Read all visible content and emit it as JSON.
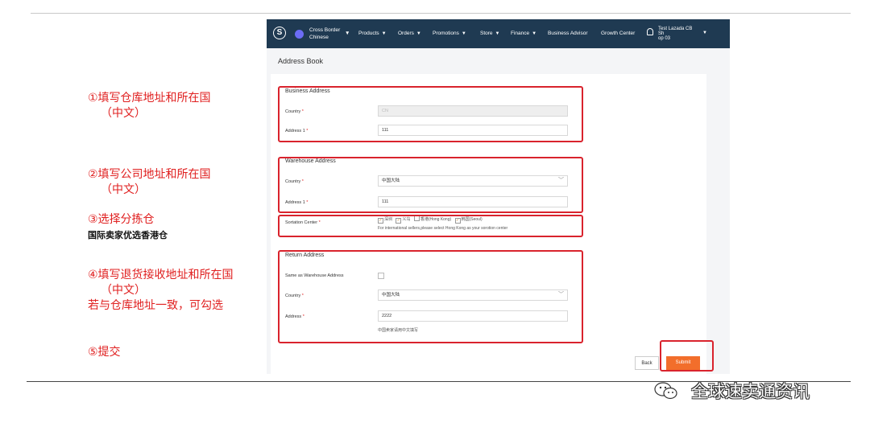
{
  "annotations": {
    "step1_line1": "①填写仓库地址和所在国",
    "step1_line2": "（中文）",
    "step2_line1": "②填写公司地址和所在国",
    "step2_line2": "（中文）",
    "step3_line1": "③选择分拣仓",
    "step3_note": "国际卖家优选香港仓",
    "step4_line1": "④填写退货接收地址和所在国",
    "step4_line2": "（中文）",
    "step4_line3": "若与仓库地址一致，可勾选",
    "step5": "⑤提交"
  },
  "topbar": {
    "logo": "S",
    "language_line1": "Cross Border",
    "language_line2": "Chinese",
    "nav": [
      "Products",
      "Orders",
      "Promotions",
      "Store",
      "Finance",
      "Business Advisor",
      "Growth Center"
    ],
    "user_line1": "Test Lazada CB",
    "user_line2": "Sh",
    "user_line3": "op 03"
  },
  "page_title": "Address Book",
  "business": {
    "title": "Business Address",
    "country_label": "Country",
    "country_value": "CN",
    "address_label": "Address 1",
    "address_value": "111"
  },
  "warehouse": {
    "title": "Warehouse Address",
    "country_label": "Country",
    "country_value": "中国大陆",
    "address_label": "Address 1",
    "address_value": "111"
  },
  "sortation": {
    "label": "Sortation Center",
    "options": [
      "深圳",
      "义乌",
      "香港(Hong Kong)",
      "韩国(Seoul)"
    ],
    "hint": "For international sellers,please select Hong Kong as your sorotion center"
  },
  "return": {
    "title": "Return Address",
    "same_label": "Same as Warehouse Address",
    "country_label": "Country",
    "country_value": "中国大陆",
    "address_label": "Address",
    "address_value": "2222",
    "hint": "中国卖家请用中文填写"
  },
  "buttons": {
    "back": "Back",
    "submit": "Submit"
  },
  "watermark": "全球速卖通资讯",
  "colors": {
    "topbar": "#1f3a52",
    "annotation_red": "#e02020",
    "submit_orange": "#f26e2b",
    "highlight_box": "#d9232d"
  }
}
